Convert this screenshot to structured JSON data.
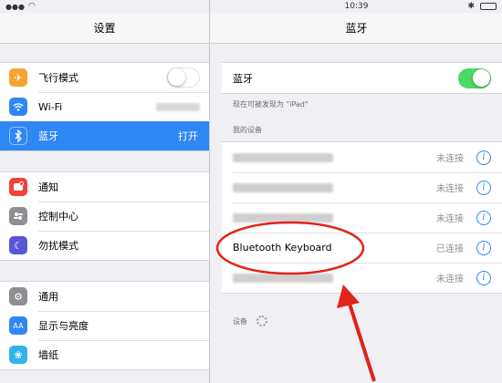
{
  "left": {
    "status_time": "",
    "title": "设置",
    "group1": [
      {
        "label": "飞行模式",
        "icon": "airplane-icon",
        "color": "#f7a233",
        "control": "toggle",
        "toggle_on": false
      },
      {
        "label": "Wi-Fi",
        "icon": "wifi-icon",
        "color": "#2f87f5",
        "control": "blurred"
      },
      {
        "label": "蓝牙",
        "icon": "bluetooth-icon",
        "color": "#2f87f5",
        "value": "打开",
        "selected": true
      }
    ],
    "group2": [
      {
        "label": "通知",
        "icon": "notification-icon",
        "color": "#f0443b"
      },
      {
        "label": "控制中心",
        "icon": "control-center-icon",
        "color": "#8e8e93"
      },
      {
        "label": "勿扰模式",
        "icon": "moon-icon",
        "color": "#5856d6"
      }
    ],
    "group3": [
      {
        "label": "通用",
        "icon": "gear-icon",
        "color": "#8e8e93"
      },
      {
        "label": "显示与亮度",
        "icon": "display-icon",
        "color": "#2f87f5"
      },
      {
        "label": "墙纸",
        "icon": "wallpaper-icon",
        "color": "#2fb3e8"
      }
    ]
  },
  "right": {
    "status_time": "10:39",
    "title": "蓝牙",
    "bluetooth_label": "蓝牙",
    "bluetooth_on": true,
    "discoverable_note": "现在可被发现为 \"iPad\"",
    "my_devices_header": "我的设备",
    "devices": [
      {
        "name": "",
        "status": "未连接"
      },
      {
        "name": "",
        "status": "未连接"
      },
      {
        "name": "",
        "status": "未连接"
      },
      {
        "name": "Bluetooth Keyboard",
        "status": "已连接"
      },
      {
        "name": "",
        "status": "未连接"
      }
    ],
    "other_devices_header": "设备"
  },
  "colors": {
    "accent": "#2f87f5",
    "toggle_on": "#4cd964",
    "annotation_red": "#e2231a"
  }
}
